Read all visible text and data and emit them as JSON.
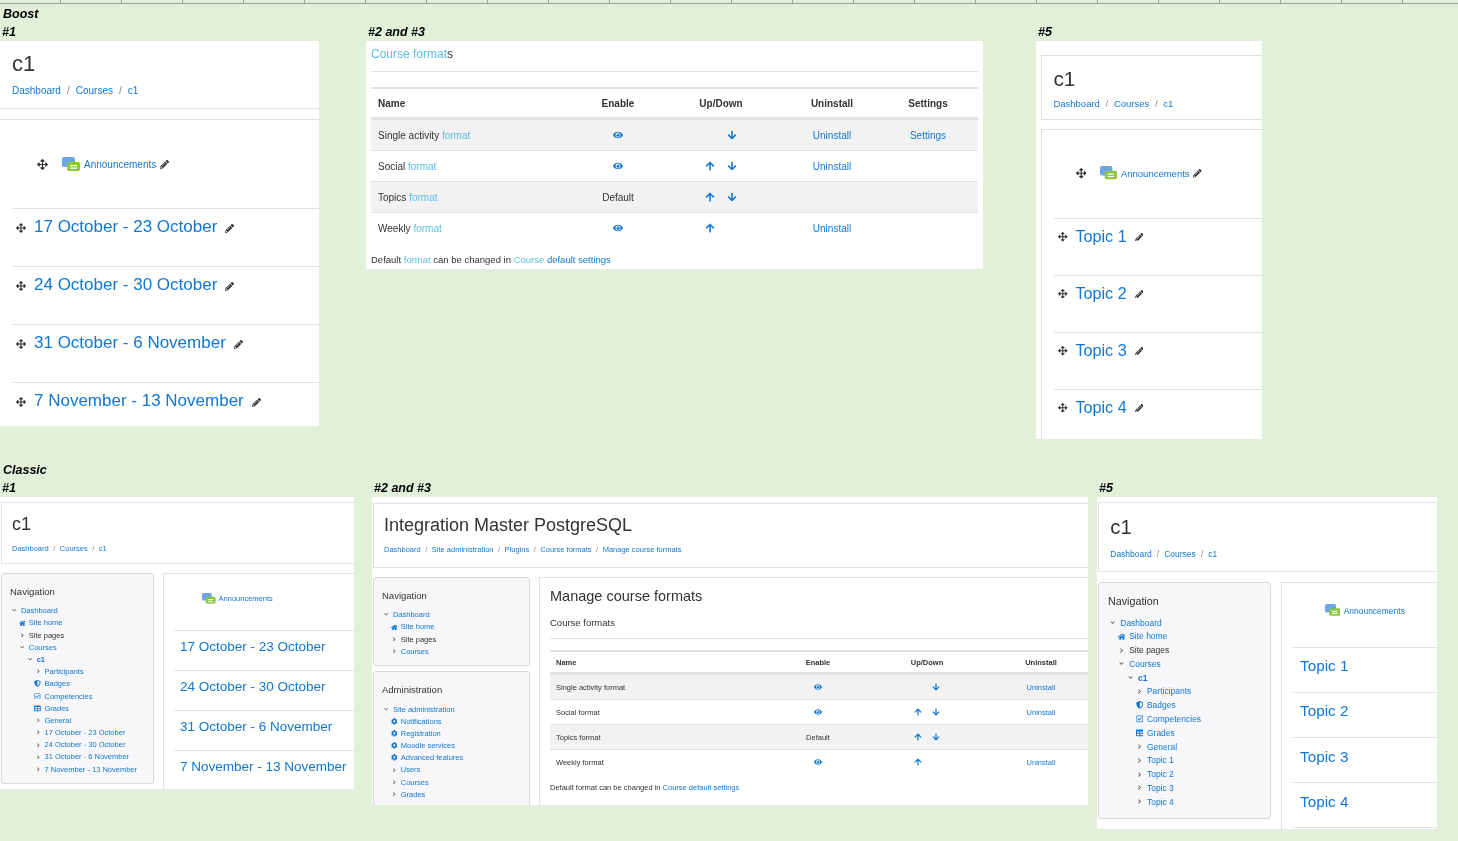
{
  "sections": [
    {
      "title": "Boost",
      "panels": [
        {
          "kind": "boost_course",
          "label": "#1",
          "editing": true,
          "course_title": "c1",
          "breadcrumb": {
            "separator": "/",
            "items": [
              "Dashboard",
              "Courses",
              "c1"
            ]
          },
          "announcements": "Announcements",
          "course_sections": [
            "17 October - 23 October",
            "24 October - 30 October",
            "31 October - 6 November",
            "7 November - 13 November"
          ]
        },
        {
          "kind": "formats_page",
          "label": "#2 and #3",
          "title": [
            {
              "text": "Course format",
              "kind": "highlight"
            },
            {
              "text": "s",
              "kind": "plain"
            }
          ],
          "table": {
            "columns": [
              "Name",
              "Enable",
              "Up/Down",
              "Uninstall",
              "Settings"
            ],
            "rows": [
              {
                "name": [
                  {
                    "text": "Single activity ",
                    "kind": "plain"
                  },
                  {
                    "text": "format",
                    "kind": "highlight"
                  }
                ],
                "enable": {
                  "kind": "eye"
                },
                "up": false,
                "down": true,
                "uninstall": "Uninstall",
                "settings": "Settings"
              },
              {
                "name": [
                  {
                    "text": "Social ",
                    "kind": "plain"
                  },
                  {
                    "text": "format",
                    "kind": "highlight"
                  }
                ],
                "enable": {
                  "kind": "eye"
                },
                "up": true,
                "down": true,
                "uninstall": "Uninstall"
              },
              {
                "name": [
                  {
                    "text": "Topics ",
                    "kind": "plain"
                  },
                  {
                    "text": "format",
                    "kind": "highlight"
                  }
                ],
                "enable": {
                  "kind": "text",
                  "text": "Default"
                },
                "up": true,
                "down": true
              },
              {
                "name": [
                  {
                    "text": "Weekly ",
                    "kind": "plain"
                  },
                  {
                    "text": "format",
                    "kind": "highlight"
                  }
                ],
                "enable": {
                  "kind": "eye"
                },
                "up": true,
                "down": false,
                "uninstall": "Uninstall"
              }
            ]
          },
          "footer": {
            "segments": [
              {
                "text": "Default ",
                "kind": "plain"
              },
              {
                "text": "format",
                "kind": "highlight"
              },
              {
                "text": " can be changed in ",
                "kind": "plain"
              }
            ],
            "link_segments": [
              {
                "text": "Course",
                "kind": "highlight"
              },
              {
                "text": " default settings",
                "kind": "link"
              }
            ]
          }
        },
        {
          "kind": "boost_course",
          "label": "#5",
          "editing": true,
          "course_title": "c1",
          "breadcrumb": {
            "separator": "/",
            "items": [
              "Dashboard",
              "Courses",
              "c1"
            ]
          },
          "announcements": "Announcements",
          "course_sections": [
            "Topic 1",
            "Topic 2",
            "Topic 3",
            "Topic 4"
          ]
        }
      ]
    },
    {
      "title": "Classic",
      "panels": [
        {
          "kind": "classic_course",
          "label": "#1",
          "editing": false,
          "course_title": "c1",
          "breadcrumb": {
            "separator": "/",
            "items": [
              "Dashboard",
              "Courses",
              "c1"
            ]
          },
          "blocks": [
            {
              "title": "Navigation",
              "items": [
                {
                  "label": "Dashboard",
                  "kind": "chevron",
                  "expanded": true,
                  "link": true,
                  "selected": false,
                  "children": [
                    {
                      "label": "Site home",
                      "kind": "home",
                      "link": true,
                      "selected": false
                    },
                    {
                      "label": "Site pages",
                      "kind": "chevron",
                      "expanded": false,
                      "link": false,
                      "selected": false
                    },
                    {
                      "label": "Courses",
                      "kind": "chevron",
                      "expanded": true,
                      "link": true,
                      "selected": false,
                      "children": [
                        {
                          "label": "c1",
                          "kind": "chevron",
                          "expanded": true,
                          "link": true,
                          "selected": true,
                          "children": [
                            {
                              "label": "Participants",
                              "kind": "chevron",
                              "expanded": false,
                              "link": true,
                              "selected": false
                            },
                            {
                              "label": "Badges",
                              "kind": "shield",
                              "link": true,
                              "selected": false
                            },
                            {
                              "label": "Competencies",
                              "kind": "checkbox",
                              "link": true,
                              "selected": false
                            },
                            {
                              "label": "Grades",
                              "kind": "table",
                              "link": true,
                              "selected": false
                            },
                            {
                              "label": "General",
                              "kind": "chevron",
                              "expanded": false,
                              "link": true,
                              "selected": false
                            },
                            {
                              "label": "17 October - 23 October",
                              "kind": "chevron",
                              "expanded": false,
                              "link": true,
                              "selected": false
                            },
                            {
                              "label": "24 October - 30 October",
                              "kind": "chevron",
                              "expanded": false,
                              "link": true,
                              "selected": false
                            },
                            {
                              "label": "31 October - 6 November",
                              "kind": "chevron",
                              "expanded": false,
                              "link": true,
                              "selected": false
                            },
                            {
                              "label": "7 November - 13 November",
                              "kind": "chevron",
                              "expanded": false,
                              "link": true,
                              "selected": false
                            }
                          ]
                        }
                      ]
                    }
                  ]
                }
              ]
            }
          ],
          "announcements": "Announcements",
          "course_sections": [
            "17 October - 23 October",
            "24 October - 30 October",
            "31 October - 6 November",
            "7 November - 13 November"
          ]
        },
        {
          "kind": "classic_admin",
          "label": "#2 and #3",
          "site_title": "Integration Master PostgreSQL",
          "breadcrumb": {
            "separator": "/",
            "items": [
              "Dashboard",
              "Site administration",
              "Plugins",
              "Course formats",
              "Manage course formats"
            ]
          },
          "blocks": [
            {
              "title": "Navigation",
              "items": [
                {
                  "label": "Dashboard",
                  "kind": "chevron",
                  "expanded": true,
                  "link": true,
                  "selected": false,
                  "children": [
                    {
                      "label": "Site home",
                      "kind": "home",
                      "link": true,
                      "selected": false
                    },
                    {
                      "label": "Site pages",
                      "kind": "chevron",
                      "expanded": false,
                      "link": false,
                      "selected": false
                    },
                    {
                      "label": "Courses",
                      "kind": "chevron",
                      "expanded": false,
                      "link": true,
                      "selected": false
                    }
                  ]
                }
              ]
            },
            {
              "title": "Administration",
              "items": [
                {
                  "label": "Site administration",
                  "kind": "chevron",
                  "expanded": true,
                  "link": true,
                  "selected": false,
                  "children": [
                    {
                      "label": "Notifications",
                      "kind": "gear",
                      "link": true,
                      "selected": false
                    },
                    {
                      "label": "Registration",
                      "kind": "gear",
                      "link": true,
                      "selected": false
                    },
                    {
                      "label": "Moodle services",
                      "kind": "gear",
                      "link": true,
                      "selected": false
                    },
                    {
                      "label": "Advanced features",
                      "kind": "gear",
                      "link": true,
                      "selected": false
                    },
                    {
                      "label": "Users",
                      "kind": "chevron",
                      "expanded": false,
                      "link": true,
                      "selected": false
                    },
                    {
                      "label": "Courses",
                      "kind": "chevron",
                      "expanded": false,
                      "link": true,
                      "selected": false
                    },
                    {
                      "label": "Grades",
                      "kind": "chevron",
                      "expanded": false,
                      "link": true,
                      "selected": false
                    }
                  ]
                }
              ]
            }
          ],
          "heading": "Manage course formats",
          "subheading": "Course formats",
          "table": {
            "columns": [
              "Name",
              "Enable",
              "Up/Down",
              "Uninstall"
            ],
            "rows": [
              {
                "name": [
                  {
                    "text": "Single activity format",
                    "kind": "plain"
                  }
                ],
                "enable": {
                  "kind": "eye"
                },
                "up": false,
                "down": true,
                "uninstall": "Uninstall"
              },
              {
                "name": [
                  {
                    "text": "Social format",
                    "kind": "plain"
                  }
                ],
                "enable": {
                  "kind": "eye"
                },
                "up": true,
                "down": true,
                "uninstall": "Uninstall"
              },
              {
                "name": [
                  {
                    "text": "Topics format",
                    "kind": "plain"
                  }
                ],
                "enable": {
                  "kind": "text",
                  "text": "Default"
                },
                "up": true,
                "down": true
              },
              {
                "name": [
                  {
                    "text": "Weekly format",
                    "kind": "plain"
                  }
                ],
                "enable": {
                  "kind": "eye"
                },
                "up": true,
                "down": false,
                "uninstall": "Uninstall"
              }
            ]
          },
          "footer": {
            "segments": [
              {
                "text": "Default format can be changed in ",
                "kind": "plain"
              }
            ],
            "link_segments": [
              {
                "text": "Course default settings",
                "kind": "link"
              }
            ]
          }
        },
        {
          "kind": "classic_course",
          "label": "#5",
          "editing": false,
          "course_title": "c1",
          "breadcrumb": {
            "separator": "/",
            "items": [
              "Dashboard",
              "Courses",
              "c1"
            ]
          },
          "blocks": [
            {
              "title": "Navigation",
              "items": [
                {
                  "label": "Dashboard",
                  "kind": "chevron",
                  "expanded": true,
                  "link": true,
                  "selected": false,
                  "children": [
                    {
                      "label": "Site home",
                      "kind": "home",
                      "link": true,
                      "selected": false
                    },
                    {
                      "label": "Site pages",
                      "kind": "chevron",
                      "expanded": false,
                      "link": false,
                      "selected": false
                    },
                    {
                      "label": "Courses",
                      "kind": "chevron",
                      "expanded": true,
                      "link": true,
                      "selected": false,
                      "children": [
                        {
                          "label": "c1",
                          "kind": "chevron",
                          "expanded": true,
                          "link": true,
                          "selected": true,
                          "children": [
                            {
                              "label": "Participants",
                              "kind": "chevron",
                              "expanded": false,
                              "link": true,
                              "selected": false
                            },
                            {
                              "label": "Badges",
                              "kind": "shield",
                              "link": true,
                              "selected": false
                            },
                            {
                              "label": "Competencies",
                              "kind": "checkbox",
                              "link": true,
                              "selected": false
                            },
                            {
                              "label": "Grades",
                              "kind": "table",
                              "link": true,
                              "selected": false
                            },
                            {
                              "label": "General",
                              "kind": "chevron",
                              "expanded": false,
                              "link": true,
                              "selected": false
                            },
                            {
                              "label": "Topic 1",
                              "kind": "chevron",
                              "expanded": false,
                              "link": true,
                              "selected": false
                            },
                            {
                              "label": "Topic 2",
                              "kind": "chevron",
                              "expanded": false,
                              "link": true,
                              "selected": false
                            },
                            {
                              "label": "Topic 3",
                              "kind": "chevron",
                              "expanded": false,
                              "link": true,
                              "selected": false
                            },
                            {
                              "label": "Topic 4",
                              "kind": "chevron",
                              "expanded": false,
                              "link": true,
                              "selected": false
                            }
                          ]
                        }
                      ]
                    }
                  ]
                }
              ]
            }
          ],
          "announcements": "Announcements",
          "course_sections": [
            "Topic 1",
            "Topic 2",
            "Topic 3",
            "Topic 4"
          ]
        }
      ]
    }
  ]
}
